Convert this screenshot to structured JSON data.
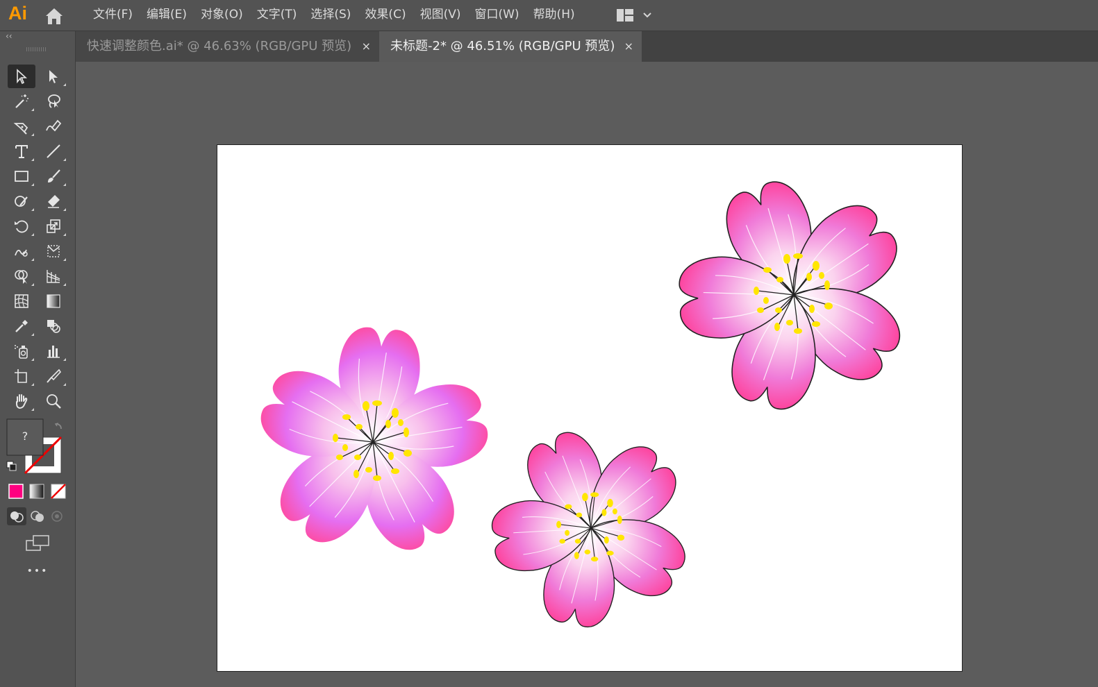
{
  "app": {
    "logo": "Ai"
  },
  "menu": [
    "文件(F)",
    "编辑(E)",
    "对象(O)",
    "文字(T)",
    "选择(S)",
    "效果(C)",
    "视图(V)",
    "窗口(W)",
    "帮助(H)"
  ],
  "tabs": [
    {
      "title": "快速调整颜色.ai* @ 46.63% (RGB/GPU 预览)",
      "close": "×",
      "active": false
    },
    {
      "title": "未标题-2* @ 46.51% (RGB/GPU 预览)",
      "close": "×",
      "active": true
    }
  ],
  "toolbar": {
    "collapse": "‹‹",
    "fill_placeholder": "?",
    "more": "•••",
    "tools": [
      "selection-tool",
      "direct-selection-tool",
      "magic-wand-tool",
      "lasso-tool",
      "pen-tool",
      "curvature-tool",
      "type-tool",
      "line-segment-tool",
      "rectangle-tool",
      "paintbrush-tool",
      "shaper-tool",
      "eraser-tool",
      "rotate-tool",
      "scale-tool",
      "warp-tool",
      "free-transform-tool",
      "shape-builder-tool",
      "perspective-grid-tool",
      "mesh-tool",
      "gradient-tool",
      "eyedropper-tool",
      "blend-tool",
      "symbol-sprayer-tool",
      "column-graph-tool",
      "artboard-tool",
      "slice-tool",
      "hand-tool",
      "zoom-tool"
    ]
  },
  "colors": {
    "accent_orange": "#ff9a00",
    "color_mode_fill": "#ff0080",
    "petal_pink": "#ff4fa0",
    "petal_violet": "#f06cf0",
    "stamen_yellow": "#ffe600"
  }
}
